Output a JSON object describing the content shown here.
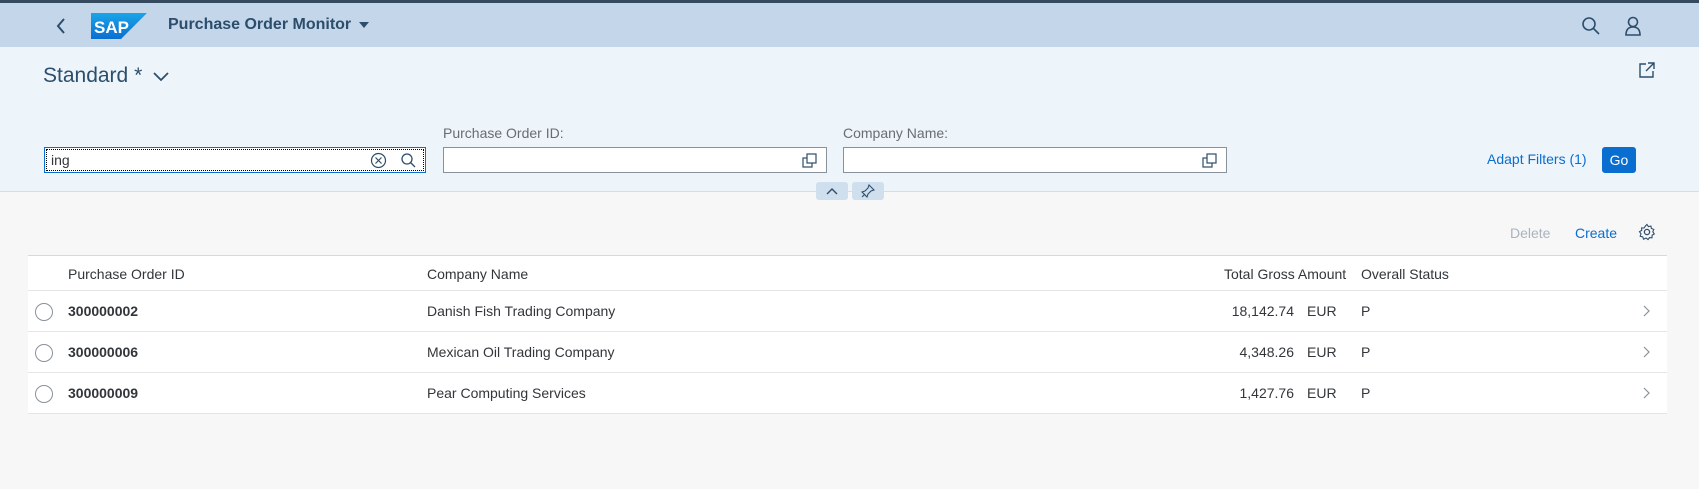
{
  "shell": {
    "title": "Purchase Order Monitor",
    "logo_text": "SAP",
    "icons": {
      "back": "back-icon",
      "search": "search-icon",
      "user": "user-icon"
    }
  },
  "header": {
    "variant": "Standard *",
    "share_icon": "share-icon"
  },
  "filters": {
    "search_value": "ing",
    "purchase_order_id": {
      "label": "Purchase Order ID:",
      "value": ""
    },
    "company_name": {
      "label": "Company Name:",
      "value": ""
    },
    "adapt_filters": "Adapt Filters (1)",
    "go": "Go"
  },
  "toolbar": {
    "delete": "Delete",
    "create": "Create",
    "settings_icon": "gear-icon"
  },
  "table": {
    "columns": [
      "Purchase Order ID",
      "Company Name",
      "Total Gross Amount",
      "Overall Status"
    ],
    "rows": [
      {
        "id": "300000002",
        "company": "Danish Fish Trading Company",
        "amount": "18,142.74",
        "currency": "EUR",
        "status": "P"
      },
      {
        "id": "300000006",
        "company": "Mexican Oil Trading Company",
        "amount": "4,348.26",
        "currency": "EUR",
        "status": "P"
      },
      {
        "id": "300000009",
        "company": "Pear Computing Services",
        "amount": "1,427.76",
        "currency": "EUR",
        "status": "P"
      }
    ]
  },
  "colors": {
    "shell_bg": "#c3d6ea",
    "header_bg": "#edf4fa",
    "accent": "#0a6ed1",
    "title": "#2c4e6c"
  }
}
